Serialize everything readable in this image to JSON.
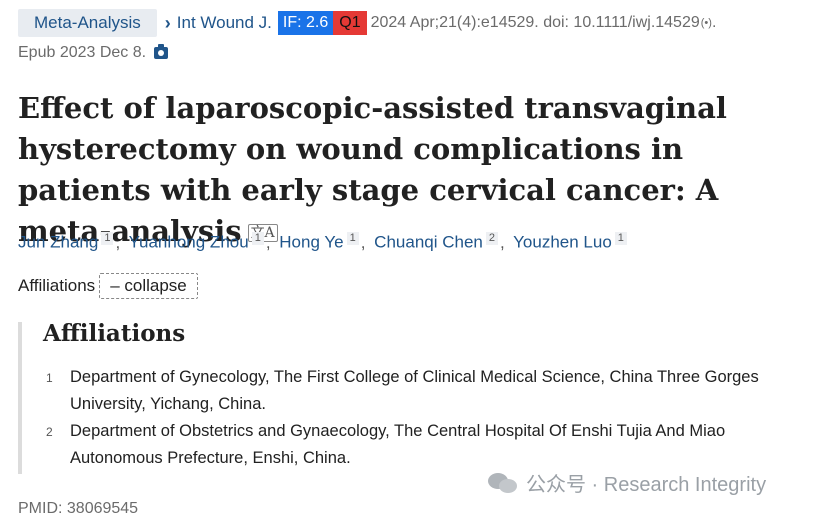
{
  "header": {
    "article_type": "Meta-Analysis",
    "journal": "Int Wound J.",
    "impact_factor": "IF: 2.6",
    "quartile": "Q1",
    "citation": "2024 Apr;21(4):e14529. doi: 10.1111/iwj.14529",
    "epub": "Epub 2023 Dec 8."
  },
  "title": "Effect of laparoscopic-assisted transvaginal hysterectomy on wound complications in patients with early stage cervical cancer: A meta-analysis",
  "authors": [
    {
      "name": "Jun Zhang",
      "aff": "1"
    },
    {
      "name": "Yuanhong Zhou",
      "aff": "1"
    },
    {
      "name": "Hong Ye",
      "aff": "1"
    },
    {
      "name": "Chuanqi Chen",
      "aff": "2"
    },
    {
      "name": "Youzhen Luo",
      "aff": "1"
    }
  ],
  "affiliations_toggle": {
    "label": "Affiliations",
    "button": "– collapse"
  },
  "affiliations": {
    "heading": "Affiliations",
    "items": [
      {
        "num": "1",
        "text": "Department of Gynecology, The First College of Clinical Medical Science, China Three Gorges University, Yichang, China."
      },
      {
        "num": "2",
        "text": "Department of Obstetrics and Gynaecology, The Central Hospital Of Enshi Tujia And Miao Autonomous Prefecture, Enshi, China."
      }
    ]
  },
  "pmid": "PMID: 38069545",
  "watermark": "公众号 · Research Integrity",
  "colors": {
    "link": "#20558a",
    "if_badge": "#1a73e8",
    "q1_badge": "#e53935"
  },
  "icons": [
    "chevron-right-icon",
    "copy-icon",
    "camera-icon",
    "translate-icon",
    "wechat-icon"
  ]
}
